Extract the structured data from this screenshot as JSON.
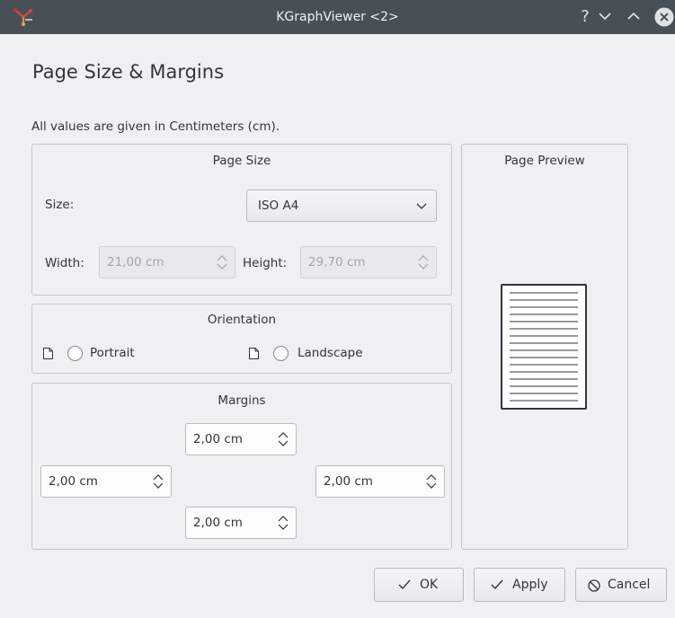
{
  "window": {
    "title": "KGraphViewer <2>",
    "help_glyph": "?",
    "min_glyph": "∨",
    "max_glyph": "∧"
  },
  "dialog": {
    "heading": "Page Size & Margins",
    "units_note": "All values are given in Centimeters (cm)."
  },
  "page_size": {
    "group_title": "Page Size",
    "size_label": "Size:",
    "size_value": "ISO A4",
    "width_label": "Width:",
    "width_value": "21,00 cm",
    "height_label": "Height:",
    "height_value": "29,70 cm"
  },
  "orientation": {
    "group_title": "Orientation",
    "portrait_label": "Portrait",
    "landscape_label": "Landscape"
  },
  "margins": {
    "group_title": "Margins",
    "top": "2,00 cm",
    "left": "2,00 cm",
    "right": "2,00 cm",
    "bottom": "2,00 cm"
  },
  "preview": {
    "group_title": "Page Preview"
  },
  "buttons": {
    "ok": "OK",
    "apply": "Apply",
    "cancel": "Cancel"
  },
  "colors": {
    "titlebar": "#475057",
    "window_bg": "#eff0f1",
    "text": "#31363b"
  }
}
